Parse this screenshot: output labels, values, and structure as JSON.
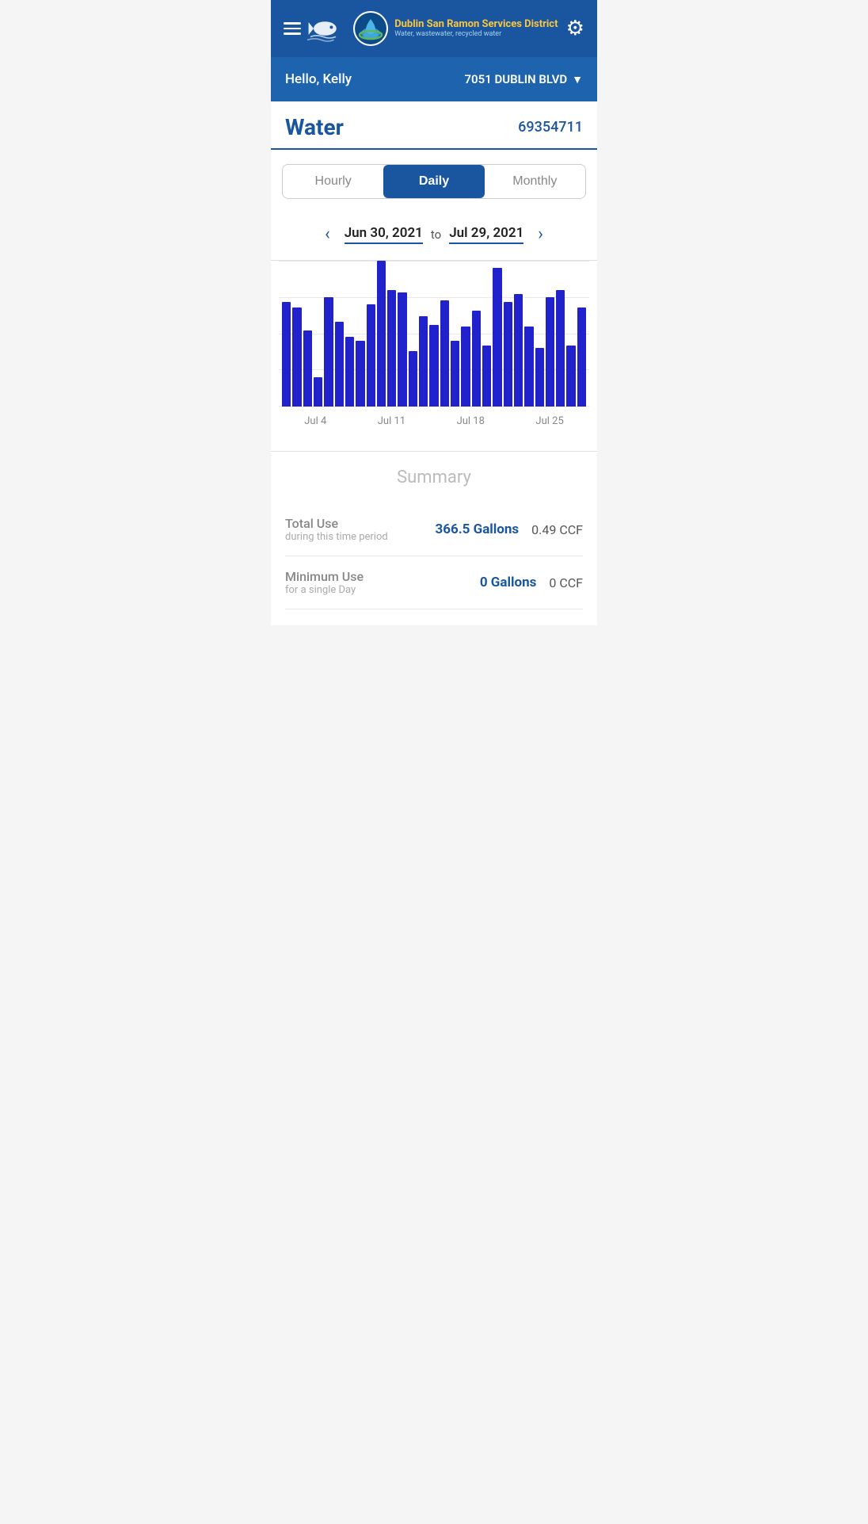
{
  "nav": {
    "menu_icon": "☰",
    "org_name": "Dublin San Ramon Services District",
    "org_subtitle": "Water, wastewater, recycled water",
    "settings_icon": "⚙",
    "gear_unicode": "⚙"
  },
  "address_bar": {
    "greeting": "Hello, Kelly",
    "address": "7051 DUBLIN BLVD",
    "chevron": "▼"
  },
  "page": {
    "title": "Water",
    "account_number": "69354711"
  },
  "tabs": [
    {
      "id": "hourly",
      "label": "Hourly",
      "active": false
    },
    {
      "id": "daily",
      "label": "Daily",
      "active": true
    },
    {
      "id": "monthly",
      "label": "Monthly",
      "active": false
    }
  ],
  "date_range": {
    "prev": "‹",
    "next": "›",
    "start": "Jun 30, 2021",
    "to": "to",
    "end": "Jul 29, 2021"
  },
  "chart": {
    "bars": [
      72,
      68,
      52,
      20,
      75,
      58,
      48,
      45,
      70,
      100,
      80,
      78,
      38,
      62,
      56,
      73,
      45,
      55,
      66,
      42,
      95,
      72,
      77,
      55,
      40,
      75,
      80,
      42,
      68
    ],
    "labels": [
      "Jul 4",
      "Jul 11",
      "Jul 18",
      "Jul 25"
    ]
  },
  "summary": {
    "title": "Summary",
    "rows": [
      {
        "id": "total-use",
        "label": "Total Use",
        "sub": "during this time period",
        "gallons": "366.5 Gallons",
        "ccf": "0.49 CCF"
      },
      {
        "id": "minimum-use",
        "label": "Minimum Use",
        "sub": "for a single Day",
        "gallons": "0 Gallons",
        "ccf": "0 CCF"
      }
    ]
  }
}
